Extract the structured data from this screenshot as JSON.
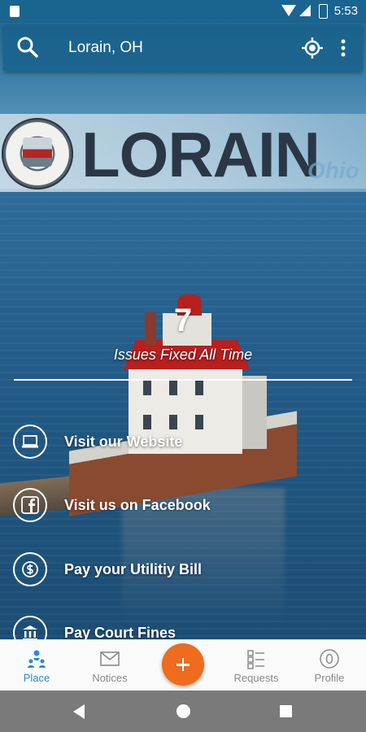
{
  "status_bar": {
    "time": "5:53"
  },
  "search_bar": {
    "location": "Lorain, OH"
  },
  "brand": {
    "name": "LORAIN",
    "sub": "Ohio"
  },
  "stats": {
    "value": "7",
    "label": "Issues Fixed All Time"
  },
  "actions": [
    {
      "label": "Visit our Website",
      "icon": "laptop-icon"
    },
    {
      "label": "Visit us on Facebook",
      "icon": "facebook-icon"
    },
    {
      "label": "Pay your Utilitiy Bill",
      "icon": "dollar-icon"
    },
    {
      "label": "Pay Court Fines",
      "icon": "courthouse-icon"
    }
  ],
  "bottom_nav": {
    "items": [
      {
        "label": "Place",
        "icon": "place-icon",
        "active": true
      },
      {
        "label": "Notices",
        "icon": "envelope-icon",
        "active": false
      },
      {
        "label": "Requests",
        "icon": "requests-icon",
        "active": false
      },
      {
        "label": "Profile",
        "icon": "profile-icon",
        "active": false
      }
    ],
    "fab_icon": "plus-icon"
  },
  "colors": {
    "toolbar": "#1a6490",
    "accent": "#2b8ad6",
    "fab": "#ef6b1d"
  }
}
